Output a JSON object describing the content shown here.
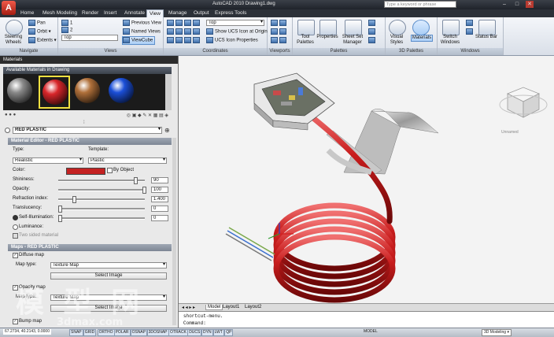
{
  "titlebar": {
    "doc_title": "AutoCAD 2010 Drawing1.dwg",
    "search_placeholder": "Type a keyword or phrase",
    "app_button": "A"
  },
  "ribbon_tabs": [
    "Home",
    "Mesh Modeling",
    "Render",
    "Insert",
    "Annotate",
    "View",
    "Manage",
    "Output",
    "Express Tools"
  ],
  "active_tab": "View",
  "ribbon": {
    "navigate": {
      "title": "Navigate",
      "steering_wheels": "Steering Wheels",
      "pan": "Pan",
      "orbit": "Orbit",
      "extents": "Extents"
    },
    "views": {
      "title": "Views",
      "previous_view": "Previous View",
      "named_views": "Named Views",
      "viewcube": "ViewCube",
      "top": "Top"
    },
    "coordinates": {
      "title": "Coordinates",
      "top": "Top",
      "show_ucs_at_origin": "Show UCS Icon at Origin",
      "ucs_icon_properties": "UCS Icon Properties"
    },
    "viewports": {
      "title": "Viewports"
    },
    "palettes": {
      "title": "Palettes",
      "tool_palettes": "Tool Palettes",
      "properties": "Properties",
      "sheet_set_manager": "Sheet Set Manager"
    },
    "palettes3d": {
      "title": "3D Palettes",
      "visual_styles": "Visual Styles",
      "materials": "Materials"
    },
    "windows": {
      "title": "Windows",
      "switch_windows": "Switch Windows",
      "status_bar": "Status Bar"
    }
  },
  "materials_palette": {
    "title": "Materials",
    "available_header": "Available Materials in Drawing",
    "current_material": "RED PLASTIC",
    "editor_header": "Material Editor - RED PLASTIC",
    "type_label": "Type:",
    "type_value": "Realistic",
    "template_label": "Template:",
    "template_value": "Plastic",
    "color_label": "Color:",
    "color_value": "#c42222",
    "by_object": "By Object",
    "shininess_label": "Shininess:",
    "shininess_value": "90",
    "opacity_label": "Opacity:",
    "opacity_value": "100",
    "refraction_label": "Refraction index:",
    "refraction_value": "1.400",
    "translucency_label": "Translucency:",
    "translucency_value": "0",
    "self_illum_label": "Self-Illumination:",
    "self_illum_value": "0",
    "luminance_label": "Luminance:",
    "two_sided_label": "Two sided material",
    "maps_header": "Maps - RED PLASTIC",
    "diffuse_map": "Diffuse map",
    "map_type_label": "Map type:",
    "map_type_value": "Texture Map",
    "select_image": "Select Image",
    "opacity_map": "Opacity map",
    "map_type_label2": "Map type:",
    "map_type_value2": "Texture Map",
    "select_image2": "Select Image",
    "bump_map": "Bump map"
  },
  "materials_swatches": [
    {
      "color": "#8a8a8a",
      "selected": false
    },
    {
      "color": "#d8262a",
      "selected": true
    },
    {
      "color": "#b0703a",
      "selected": false
    },
    {
      "color": "#1b4fd8",
      "selected": false
    }
  ],
  "viewport": {
    "viewcube_label": "Unnamed"
  },
  "layout_tabs": [
    "Model",
    "Layout1",
    "Layout2"
  ],
  "command_lines": [
    "shortcut-menu.",
    "Command:"
  ],
  "status_bar": {
    "coords": "67.2734, 40.2143, 0.0000",
    "toggles": [
      "SNAP",
      "GRID",
      "ORTHO",
      "POLAR",
      "OSNAP",
      "3DOSNAP",
      "OTRACK",
      "DUCS",
      "DYN",
      "LWT",
      "QP"
    ],
    "model": "MODEL",
    "workspace": "3D Modeling"
  },
  "watermark": {
    "cn": "模 型 网",
    "url": "3dmax.com"
  }
}
